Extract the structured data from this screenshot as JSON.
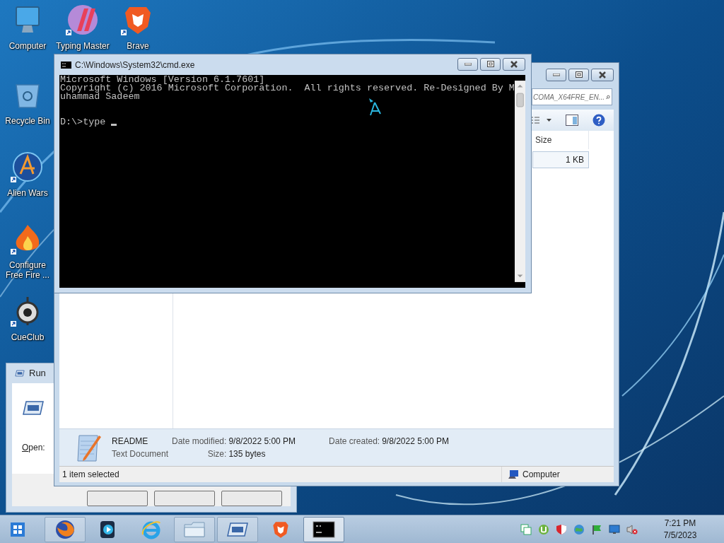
{
  "desktop_icons": [
    {
      "kind": "computer",
      "label": "Computer",
      "shortcut": false
    },
    {
      "kind": "typing",
      "label": "Typing Master",
      "shortcut": true
    },
    {
      "kind": "brave",
      "label": "Brave",
      "shortcut": true
    },
    {
      "kind": "recycle",
      "label": "Recycle Bin",
      "shortcut": false
    },
    {
      "kind": "alien",
      "label": "Alien Wars",
      "shortcut": true
    },
    {
      "kind": "fire",
      "label": "Configure Free Fire ...",
      "shortcut": true
    },
    {
      "kind": "cue",
      "label": "CueClub",
      "shortcut": true
    }
  ],
  "run_dialog": {
    "title": "Run",
    "open_label": "Open:"
  },
  "explorer": {
    "search_placeholder": "COMA_X64FRE_EN...",
    "columns": [
      "Size"
    ],
    "rows": [
      {
        "size": "1 KB",
        "selected": true
      }
    ],
    "details": {
      "name": "README",
      "type": "Text Document",
      "modified_label": "Date modified:",
      "modified": "9/8/2022 5:00 PM",
      "size_label": "Size:",
      "size": "135 bytes",
      "created_label": "Date created:",
      "created": "9/8/2022 5:00 PM"
    },
    "status": "1 item selected",
    "location": "Computer"
  },
  "cmd": {
    "title": "C:\\Windows\\System32\\cmd.exe",
    "output": [
      "Microsoft Windows [Version 6.1.7601]",
      "Copyright (c) 2016 Microsoft Corporation.  All rights reserved. Re-Designed By M",
      "uhammad Sadeem"
    ],
    "prompt": "D:\\>type"
  },
  "taskbar": {
    "items": [
      {
        "kind": "start",
        "open": false,
        "selected": false
      },
      {
        "kind": "firefox",
        "open": true,
        "selected": false
      },
      {
        "kind": "media",
        "open": false,
        "selected": false
      },
      {
        "kind": "ie",
        "open": false,
        "selected": false
      },
      {
        "kind": "folder",
        "open": true,
        "selected": false
      },
      {
        "kind": "run",
        "open": true,
        "selected": false
      },
      {
        "kind": "brave",
        "open": false,
        "selected": false
      },
      {
        "kind": "cmd",
        "open": true,
        "selected": true
      }
    ]
  },
  "tray": [
    {
      "kind": "windows"
    },
    {
      "kind": "utorrent"
    },
    {
      "kind": "shield"
    },
    {
      "kind": "globe"
    },
    {
      "kind": "flag"
    },
    {
      "kind": "network"
    },
    {
      "kind": "volume-muted"
    }
  ],
  "clock": {
    "time": "7:21 PM",
    "date": "7/5/2023"
  }
}
